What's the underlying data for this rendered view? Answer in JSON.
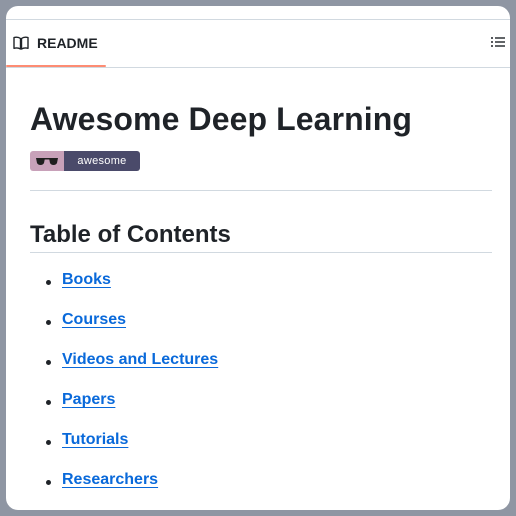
{
  "header": {
    "tab_label": "README",
    "tab_icon": "book-icon",
    "toc_icon": "list-unordered-icon"
  },
  "readme": {
    "title": "Awesome Deep Learning",
    "badge": {
      "icon": "sunglasses-icon",
      "text": "awesome"
    },
    "toc_heading": "Table of Contents",
    "toc_items": [
      {
        "label": "Books"
      },
      {
        "label": "Courses"
      },
      {
        "label": "Videos and Lectures"
      },
      {
        "label": "Papers"
      },
      {
        "label": "Tutorials"
      },
      {
        "label": "Researchers"
      }
    ]
  },
  "colors": {
    "accent_underline": "#fd8c73",
    "link": "#0969da",
    "text": "#1f2328",
    "border": "#d1d9e0",
    "badge_left": "#c8a1b9",
    "badge_right": "#4a4a6a"
  }
}
